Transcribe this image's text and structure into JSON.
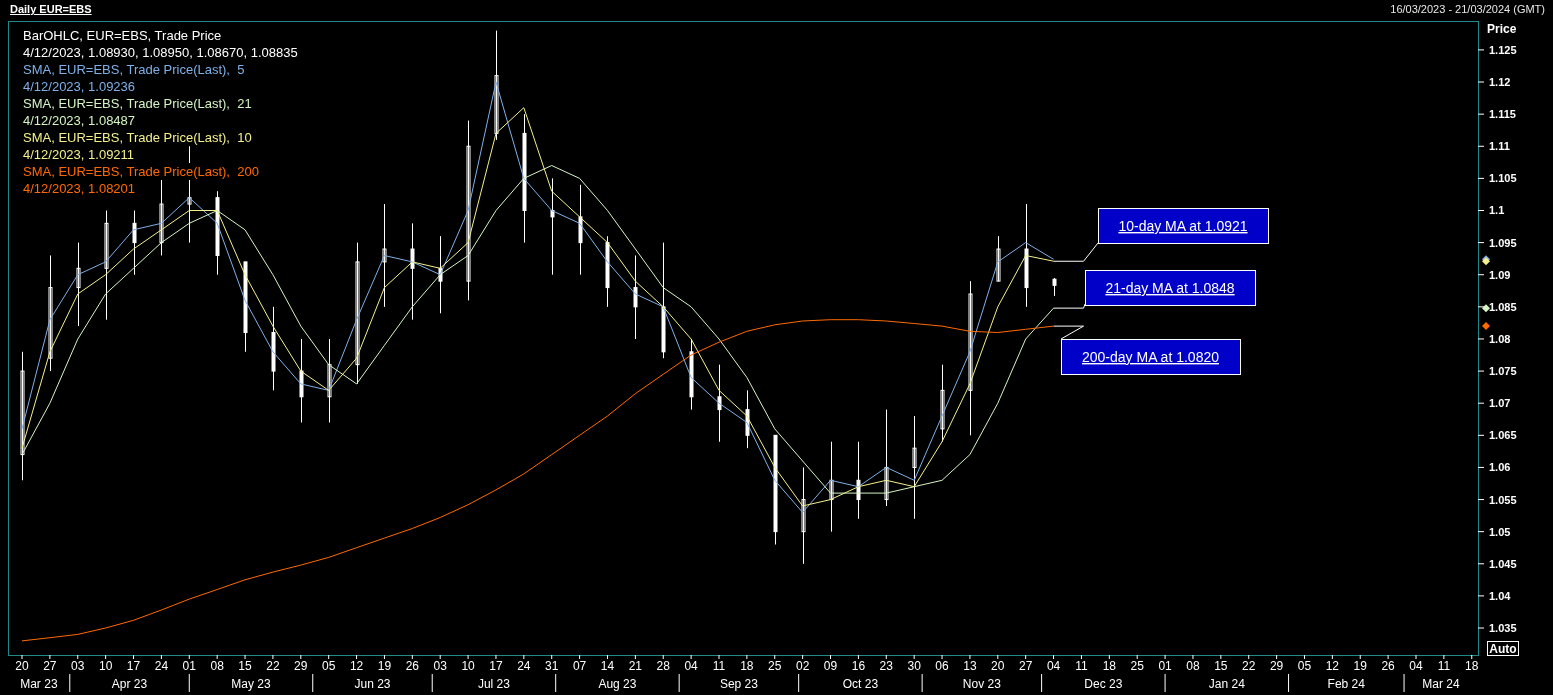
{
  "header": {
    "title": "Daily EUR=EBS",
    "date_range": "16/03/2023 - 21/03/2024 (GMT)"
  },
  "legend": [
    {
      "text": "BarOHLC, EUR=EBS, Trade Price",
      "color": "#ffffff"
    },
    {
      "text": "4/12/2023, 1.08930, 1.08950, 1.08670, 1.08835",
      "color": "#ffffff"
    },
    {
      "text": "4/12/2023, 1.09236",
      "color": "#7fb0e8"
    },
    {
      "text": "4/12/2023, 1.08487",
      "color": "#d4f4c4"
    },
    {
      "text": "4/12/2023, 1.09211",
      "color": "#f4f08c"
    },
    {
      "text": "4/12/2023, 1.08201",
      "color": "#ff6a00"
    }
  ],
  "chart": {
    "auto_button": "Auto",
    "months": [
      "Mar 23",
      "Apr 23",
      "May 23",
      "Jun 23",
      "Jul 23",
      "Aug 23",
      "Sep 23",
      "Oct 23",
      "Nov 23",
      "Dec 23",
      "Jan 24",
      "Feb 24",
      "Mar 24"
    ],
    "chart_data": {
      "type": "line",
      "ylabel": "Price",
      "categories": [
        "20",
        "27",
        "03",
        "10",
        "17",
        "24",
        "01",
        "08",
        "15",
        "22",
        "29",
        "05",
        "12",
        "19",
        "26",
        "03",
        "10",
        "17",
        "24",
        "31",
        "07",
        "14",
        "21",
        "28",
        "04",
        "11",
        "18",
        "25",
        "02",
        "09",
        "16",
        "23",
        "30",
        "06",
        "13",
        "20",
        "27",
        "04",
        "11",
        "18",
        "25",
        "01",
        "08",
        "15",
        "22",
        "29",
        "05",
        "12",
        "19",
        "26",
        "04",
        "11",
        "18"
      ],
      "ylim": [
        1.0308,
        1.1295
      ],
      "yticks": [
        1.035,
        1.04,
        1.045,
        1.05,
        1.055,
        1.06,
        1.065,
        1.07,
        1.075,
        1.08,
        1.085,
        1.09,
        1.095,
        1.1,
        1.105,
        1.11,
        1.115,
        1.12,
        1.125
      ],
      "series": [
        {
          "name": "SMA, EUR=EBS, Trade Price(Last),  5",
          "color": "#7fb0e8",
          "values": [
            1.066,
            1.083,
            1.09,
            1.092,
            1.097,
            1.098,
            1.102,
            1.098,
            1.086,
            1.078,
            1.073,
            1.072,
            1.083,
            1.093,
            1.092,
            1.09,
            1.1,
            1.12,
            1.105,
            1.1,
            1.098,
            1.092,
            1.087,
            1.085,
            1.074,
            1.07,
            1.067,
            1.058,
            1.053,
            1.058,
            1.057,
            1.06,
            1.058,
            1.068,
            1.078,
            1.092,
            1.095,
            1.0924,
            null,
            null,
            null,
            null,
            null,
            null,
            null,
            null,
            null,
            null,
            null,
            null,
            null,
            null,
            null
          ]
        },
        {
          "name": "SMA, EUR=EBS, Trade Price(Last),  21",
          "color": "#d4f4c4",
          "values": [
            1.062,
            1.07,
            1.08,
            1.087,
            1.091,
            1.095,
            1.098,
            1.1,
            1.097,
            1.09,
            1.082,
            1.076,
            1.073,
            1.079,
            1.085,
            1.09,
            1.093,
            1.1,
            1.105,
            1.107,
            1.105,
            1.1,
            1.094,
            1.088,
            1.085,
            1.08,
            1.074,
            1.066,
            1.061,
            1.056,
            1.056,
            1.056,
            1.057,
            1.058,
            1.062,
            1.07,
            1.08,
            1.0848,
            null,
            null,
            null,
            null,
            null,
            null,
            null,
            null,
            null,
            null,
            null,
            null,
            null,
            null,
            null
          ]
        },
        {
          "name": "SMA, EUR=EBS, Trade Price(Last),  10",
          "color": "#f4f08c",
          "values": [
            1.063,
            1.078,
            1.087,
            1.09,
            1.094,
            1.097,
            1.1,
            1.1,
            1.09,
            1.082,
            1.075,
            1.072,
            1.077,
            1.088,
            1.092,
            1.091,
            1.095,
            1.112,
            1.116,
            1.103,
            1.099,
            1.095,
            1.089,
            1.085,
            1.08,
            1.072,
            1.068,
            1.06,
            1.054,
            1.055,
            1.057,
            1.058,
            1.057,
            1.064,
            1.073,
            1.085,
            1.093,
            1.0921,
            null,
            null,
            null,
            null,
            null,
            null,
            null,
            null,
            null,
            null,
            null,
            null,
            null,
            null,
            null
          ]
        },
        {
          "name": "SMA, EUR=EBS, Trade Price(Last),  200",
          "color": "#ff6a00",
          "values": [
            1.033,
            1.0335,
            1.034,
            1.035,
            1.0362,
            1.0378,
            1.0395,
            1.041,
            1.0425,
            1.0437,
            1.0448,
            1.046,
            1.0475,
            1.049,
            1.0505,
            1.0522,
            1.0542,
            1.0565,
            1.059,
            1.062,
            1.065,
            1.068,
            1.0715,
            1.0745,
            1.0775,
            1.0795,
            1.0812,
            1.0822,
            1.0828,
            1.083,
            1.083,
            1.0828,
            1.0824,
            1.082,
            1.0812,
            1.081,
            1.0815,
            1.082,
            null,
            null,
            null,
            null,
            null,
            null,
            null,
            null,
            null,
            null,
            null,
            null,
            null,
            null,
            null
          ]
        }
      ],
      "annotations": [
        "10-day MA at 1.0921",
        "21-day MA at 1.0848",
        "200-day MA at 1.0820"
      ]
    }
  },
  "price_bars": {
    "chart_data": {
      "type": "candlestick",
      "ylim": [
        1.0308,
        1.1295
      ],
      "ohlc": [
        [
          1.062,
          1.078,
          1.058,
          1.075
        ],
        [
          1.077,
          1.093,
          1.075,
          1.088
        ],
        [
          1.088,
          1.095,
          1.082,
          1.091
        ],
        [
          1.091,
          1.1,
          1.083,
          1.098
        ],
        [
          1.098,
          1.1,
          1.09,
          1.095
        ],
        [
          1.095,
          1.105,
          1.093,
          1.101
        ],
        [
          1.101,
          1.11,
          1.095,
          1.102
        ],
        [
          1.102,
          1.103,
          1.09,
          1.093
        ],
        [
          1.092,
          1.092,
          1.078,
          1.081
        ],
        [
          1.081,
          1.085,
          1.072,
          1.075
        ],
        [
          1.075,
          1.08,
          1.067,
          1.071
        ],
        [
          1.071,
          1.08,
          1.067,
          1.076
        ],
        [
          1.076,
          1.095,
          1.073,
          1.092
        ],
        [
          1.092,
          1.101,
          1.085,
          1.094
        ],
        [
          1.094,
          1.098,
          1.083,
          1.091
        ],
        [
          1.091,
          1.096,
          1.084,
          1.089
        ],
        [
          1.089,
          1.114,
          1.086,
          1.11
        ],
        [
          1.112,
          1.128,
          1.111,
          1.121
        ],
        [
          1.112,
          1.115,
          1.095,
          1.1
        ],
        [
          1.1,
          1.105,
          1.09,
          1.099
        ],
        [
          1.099,
          1.104,
          1.09,
          1.095
        ],
        [
          1.095,
          1.096,
          1.085,
          1.088
        ],
        [
          1.088,
          1.093,
          1.08,
          1.085
        ],
        [
          1.085,
          1.095,
          1.077,
          1.078
        ],
        [
          1.078,
          1.08,
          1.069,
          1.071
        ],
        [
          1.071,
          1.076,
          1.064,
          1.069
        ],
        [
          1.069,
          1.072,
          1.063,
          1.065
        ],
        [
          1.065,
          1.065,
          1.048,
          1.05
        ],
        [
          1.05,
          1.06,
          1.045,
          1.055
        ],
        [
          1.055,
          1.064,
          1.05,
          1.058
        ],
        [
          1.058,
          1.064,
          1.052,
          1.055
        ],
        [
          1.055,
          1.069,
          1.054,
          1.06
        ],
        [
          1.06,
          1.068,
          1.052,
          1.063
        ],
        [
          1.066,
          1.076,
          1.064,
          1.072
        ],
        [
          1.072,
          1.089,
          1.065,
          1.087
        ],
        [
          1.089,
          1.096,
          1.089,
          1.094
        ],
        [
          1.094,
          1.101,
          1.085,
          1.088
        ],
        [
          1.0893,
          1.0895,
          1.0867,
          1.08835
        ],
        null,
        null,
        null,
        null,
        null,
        null,
        null,
        null,
        null,
        null,
        null,
        null,
        null,
        null,
        null
      ]
    }
  }
}
